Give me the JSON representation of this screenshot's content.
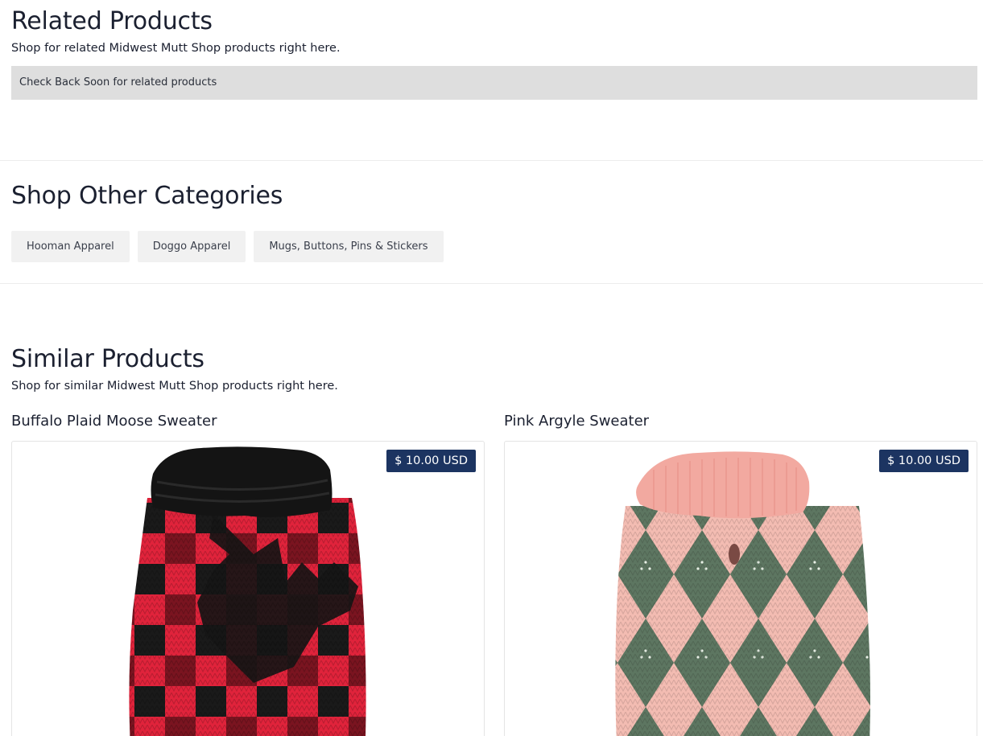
{
  "related": {
    "title": "Related Products",
    "subtitle": "Shop for related Midwest Mutt Shop products right here.",
    "notice": "Check Back Soon for related products"
  },
  "categories": {
    "title": "Shop Other Categories",
    "items": [
      {
        "label": "Hooman Apparel"
      },
      {
        "label": "Doggo Apparel"
      },
      {
        "label": "Mugs, Buttons, Pins & Stickers"
      }
    ]
  },
  "similar": {
    "title": "Similar Products",
    "subtitle": "Shop for similar Midwest Mutt Shop products right here.",
    "products": [
      {
        "name": "Buffalo Plaid Moose Sweater",
        "price": "$ 10.00 USD",
        "image_icon": "dog-sweater-red-plaid-image"
      },
      {
        "name": "Pink Argyle Sweater",
        "price": "$ 10.00 USD",
        "image_icon": "dog-sweater-pink-argyle-image"
      }
    ]
  },
  "colors": {
    "badge": "#1c3461",
    "notice_bg": "#dedede",
    "category_bg": "#f1f1f1",
    "plaid_red": "#e0233b",
    "plaid_black": "#151515",
    "argyle_pink": "#f3bcb2",
    "argyle_green": "#5d7661"
  }
}
